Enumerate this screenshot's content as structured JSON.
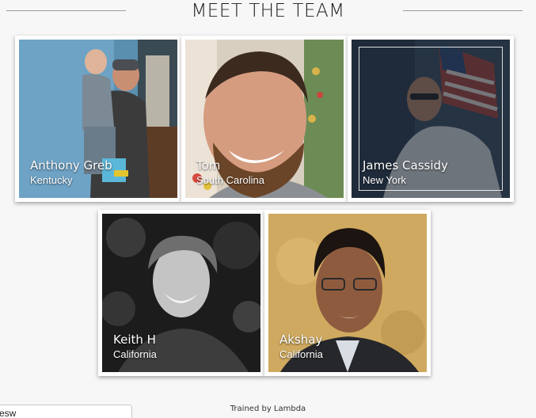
{
  "page": {
    "title": "MEET THE TEAM",
    "footer": "Trained by Lambda",
    "corner_input_value": "esw"
  },
  "team": [
    {
      "name": "Anthony Greb",
      "location": "Kentucky"
    },
    {
      "name": "Tom",
      "location": "South Carolina"
    },
    {
      "name": "James Cassidy",
      "location": "New York"
    },
    {
      "name": "Keith H",
      "location": "California"
    },
    {
      "name": "Akshay",
      "location": "California"
    }
  ]
}
